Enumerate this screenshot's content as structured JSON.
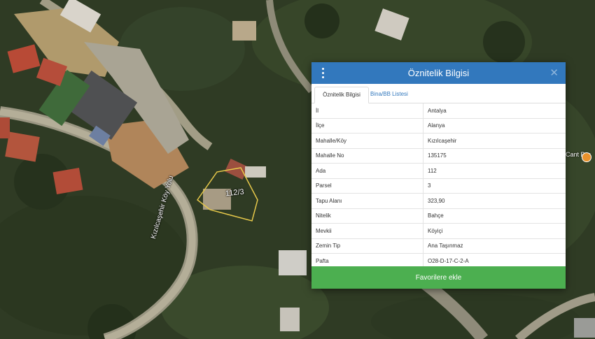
{
  "map": {
    "parcel_label": "112/3",
    "road_label": "Kızılcaşehir Köy Yolu",
    "poi_label": "Cant Bar"
  },
  "dialog": {
    "title": "Öznitelik Bilgisi",
    "tabs": [
      {
        "label": "Öznitelik Bilgisi",
        "active": true
      },
      {
        "label": "Bina/BB Listesi",
        "active": false
      }
    ],
    "rows": [
      {
        "key": "İl",
        "value": "Antalya"
      },
      {
        "key": "İlçe",
        "value": "Alanya"
      },
      {
        "key": "Mahalle/Köy",
        "value": "Kızılcaşehir"
      },
      {
        "key": "Mahalle No",
        "value": "135175"
      },
      {
        "key": "Ada",
        "value": "112"
      },
      {
        "key": "Parsel",
        "value": "3"
      },
      {
        "key": "Tapu Alanı",
        "value": "323,90"
      },
      {
        "key": "Nitelik",
        "value": "Bahçe"
      },
      {
        "key": "Mevkii",
        "value": "Köyiçi"
      },
      {
        "key": "Zemin Tip",
        "value": "Ana Taşınmaz"
      },
      {
        "key": "Pafta",
        "value": "O28-D-17-C-2-A"
      }
    ],
    "favorite_button": "Favorilere ekle",
    "close_icon": "close-icon",
    "menu_icon": "kebab-menu-icon"
  },
  "colors": {
    "header": "#3278bd",
    "favorite_button": "#4caf50",
    "tab_link": "#3278bd",
    "parcel_outline": "#e6c84a"
  }
}
